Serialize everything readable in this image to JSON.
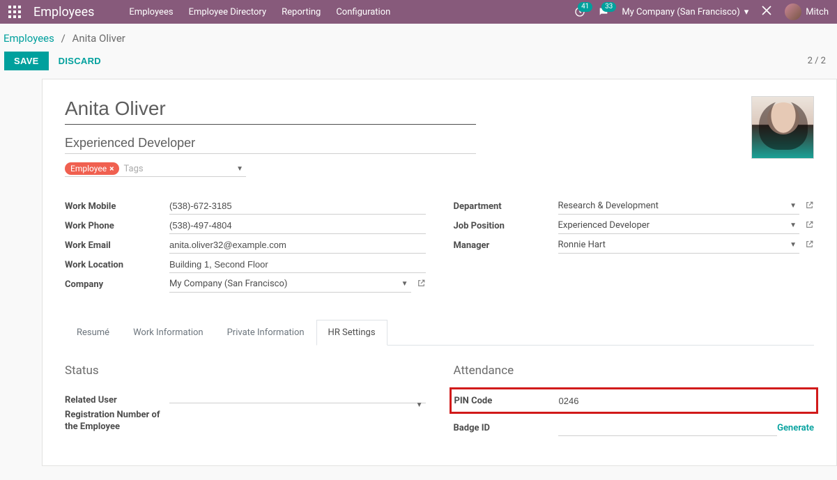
{
  "topbar": {
    "brand": "Employees",
    "menu": [
      "Employees",
      "Employee Directory",
      "Reporting",
      "Configuration"
    ],
    "clock_badge": "41",
    "chat_badge": "33",
    "company": "My Company (San Francisco)",
    "user_name": "Mitch"
  },
  "breadcrumbs": {
    "root": "Employees",
    "current": "Anita Oliver"
  },
  "actions": {
    "save": "SAVE",
    "discard": "DISCARD",
    "pager": "2 / 2"
  },
  "record": {
    "name": "Anita Oliver",
    "title": "Experienced Developer",
    "tag": "Employee",
    "tags_placeholder": "Tags",
    "left": {
      "work_mobile_label": "Work Mobile",
      "work_mobile": "(538)-672-3185",
      "work_phone_label": "Work Phone",
      "work_phone": "(538)-497-4804",
      "work_email_label": "Work Email",
      "work_email": "anita.oliver32@example.com",
      "work_location_label": "Work Location",
      "work_location": "Building 1, Second Floor",
      "company_label": "Company",
      "company": "My Company (San Francisco)"
    },
    "right": {
      "department_label": "Department",
      "department": "Research & Development",
      "job_label": "Job Position",
      "job": "Experienced Developer",
      "manager_label": "Manager",
      "manager": "Ronnie Hart"
    }
  },
  "tabs": {
    "resume": "Resumé",
    "work_info": "Work Information",
    "private_info": "Private Information",
    "hr_settings": "HR Settings"
  },
  "hr": {
    "status_title": "Status",
    "related_user_label": "Related User",
    "related_user": "",
    "reg_number_label": "Registration Number of the Employee",
    "attendance_title": "Attendance",
    "pin_label": "PIN Code",
    "pin": "0246",
    "badge_label": "Badge ID",
    "badge": "",
    "generate": "Generate"
  }
}
